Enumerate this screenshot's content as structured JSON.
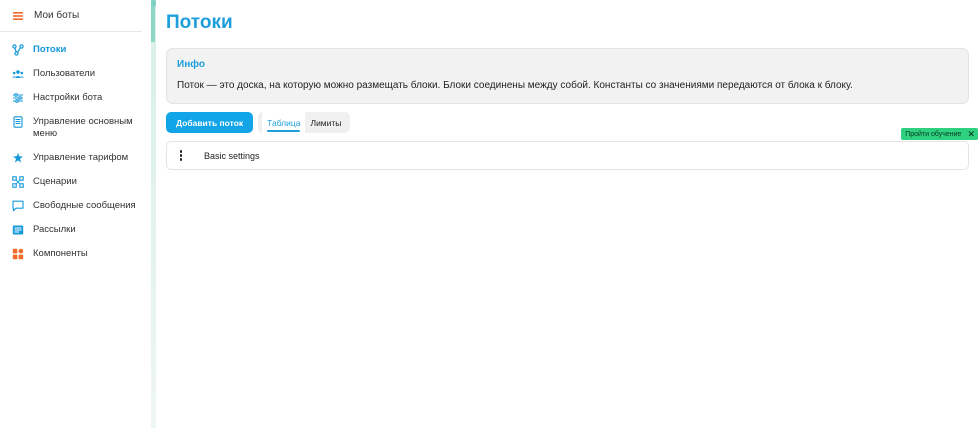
{
  "sidebar": {
    "top": {
      "label": "Мои боты",
      "icon": "hamburger-icon"
    },
    "items": [
      {
        "label": "Потоки",
        "icon": "flow-icon",
        "active": true
      },
      {
        "label": "Пользователи",
        "icon": "users-icon"
      },
      {
        "label": "Настройки бота",
        "icon": "sliders-icon"
      },
      {
        "label": "Управление основным меню",
        "icon": "menu-device-icon"
      },
      {
        "label": "Управление тарифом",
        "icon": "tariff-icon"
      },
      {
        "label": "Сценарии",
        "icon": "scenario-icon"
      },
      {
        "label": "Свободные сообщения",
        "icon": "chat-icon"
      },
      {
        "label": "Рассылки",
        "icon": "mailing-icon"
      },
      {
        "label": "Компоненты",
        "icon": "components-icon"
      }
    ]
  },
  "main": {
    "title": "Потоки",
    "info": {
      "title": "Инфо",
      "text": "Поток — это доска, на которую можно размещать блоки. Блоки соединены между собой. Константы со значениями передаются от блока к блоку."
    },
    "add_button": "Добавить поток",
    "tabs": [
      {
        "label": "Таблица",
        "active": true
      },
      {
        "label": "Лимиты",
        "active": false
      }
    ],
    "rows": [
      {
        "label": "Basic settings"
      }
    ],
    "tutorial": {
      "label": "Пройти обучение",
      "close": "✕"
    }
  },
  "colors": {
    "accent": "#1d9fdc",
    "button": "#11a4e6",
    "tutorial_bg": "#2fd07f",
    "icon_blue": "#1598d8",
    "icon_orange": "#f26a2a"
  }
}
